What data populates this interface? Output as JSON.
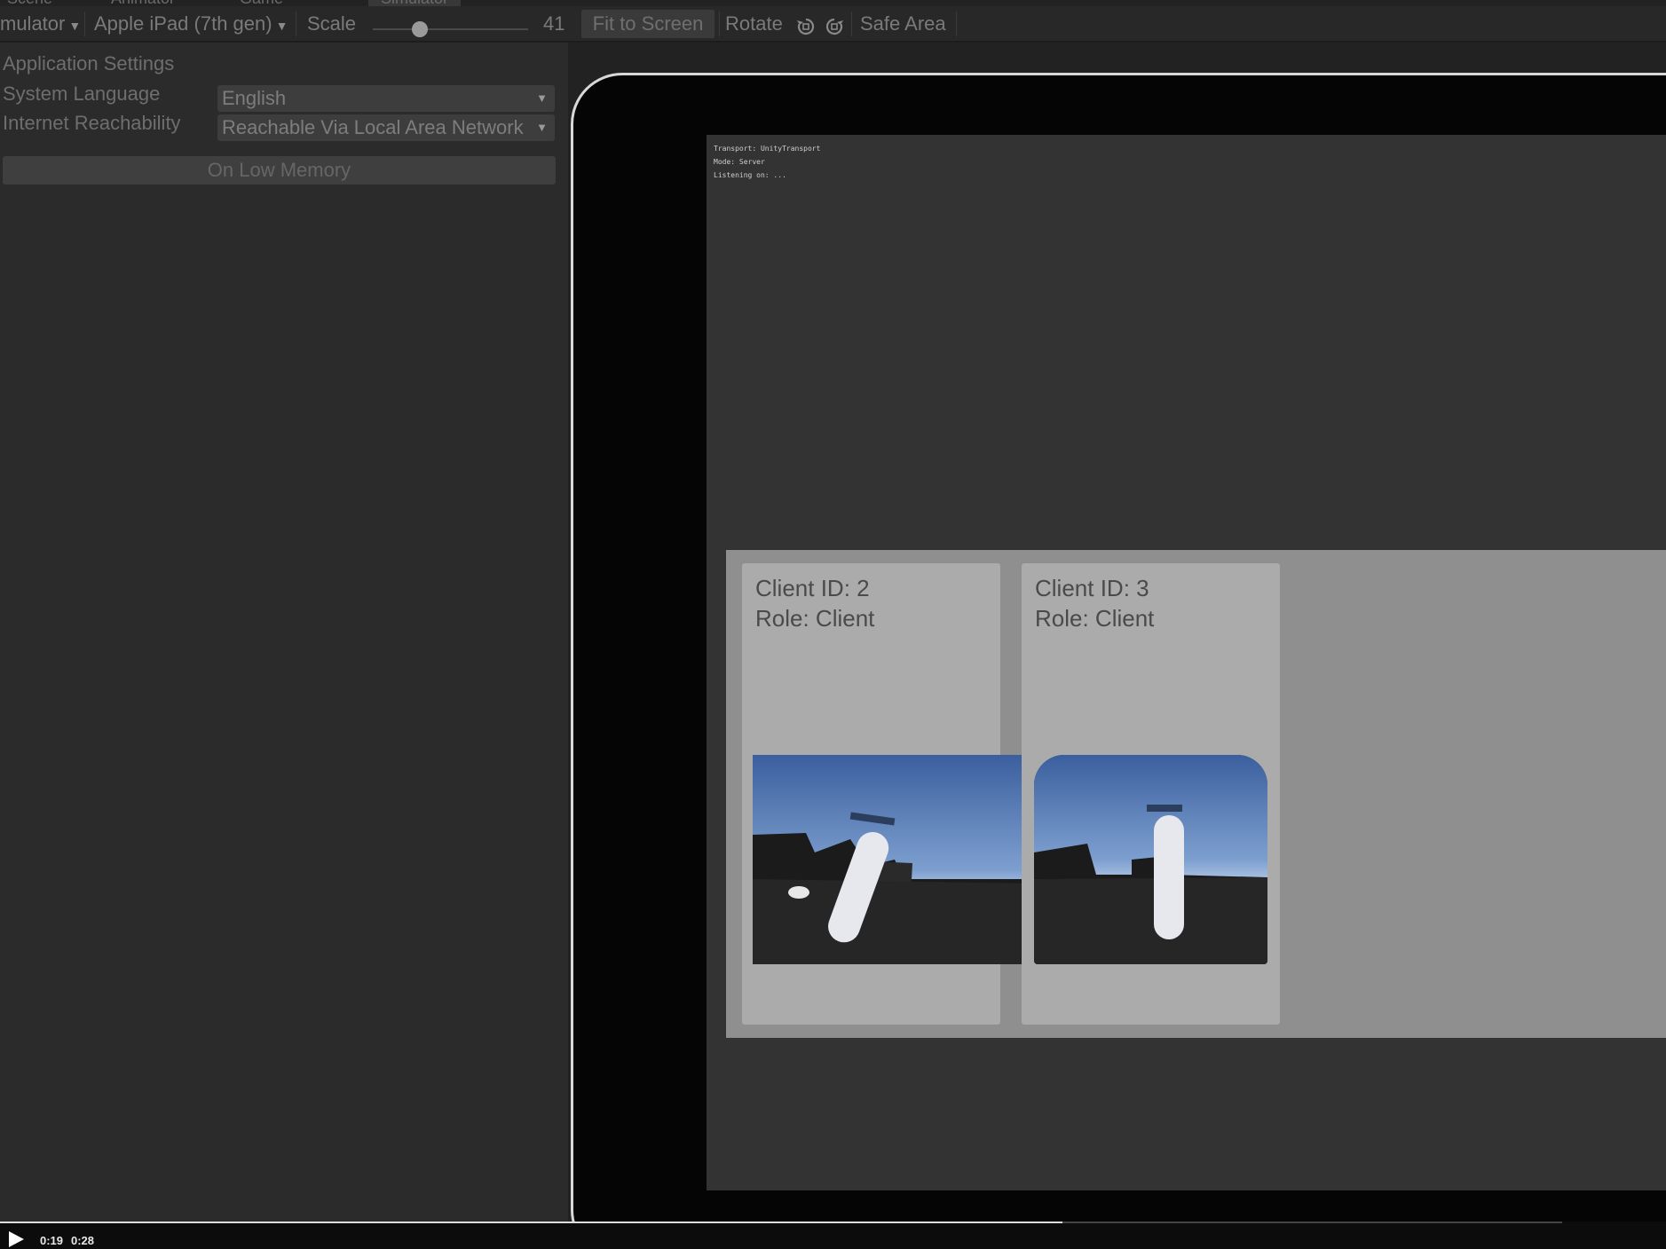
{
  "tabs": {
    "scene": "Scene",
    "animator": "Animator",
    "game": "Game",
    "simulator": "Simulator"
  },
  "toolbar": {
    "mode": "mulator",
    "device": "Apple iPad (7th gen)",
    "scale_label": "Scale",
    "scale_value": "41",
    "scale_fraction": 0.3,
    "fit_to_screen": "Fit to Screen",
    "rotate": "Rotate",
    "safe_area": "Safe Area"
  },
  "app_settings": {
    "heading": "Application Settings",
    "system_language_label": "System Language",
    "system_language_value": "English",
    "internet_label": "Internet Reachability",
    "internet_value": "Reachable Via Local Area Network",
    "low_memory_button": "On Low Memory"
  },
  "screen": {
    "debug_lines": [
      "Transport: UnityTransport",
      "Mode: Server",
      "Listening on: ..."
    ],
    "cards": [
      {
        "client_id": "Client ID: 2",
        "role": "Role:  Client"
      },
      {
        "client_id": "Client ID: 3",
        "role": "Role:  Client"
      }
    ]
  },
  "video": {
    "current": "0:19",
    "total": "0:28",
    "progress_fraction": 0.68
  },
  "colors": {
    "panel_bg": "#2b2b2b",
    "toolbar_bg": "#282828",
    "device_frame": "#d8d8d8",
    "card_bg": "#ababab",
    "cards_panel_bg": "#8f8f8f"
  },
  "icons": {
    "device_dropdown": "chevron-down-icon",
    "rotate_left": "rotate-ccw-icon",
    "rotate_right": "rotate-cw-icon",
    "play": "play-icon"
  }
}
